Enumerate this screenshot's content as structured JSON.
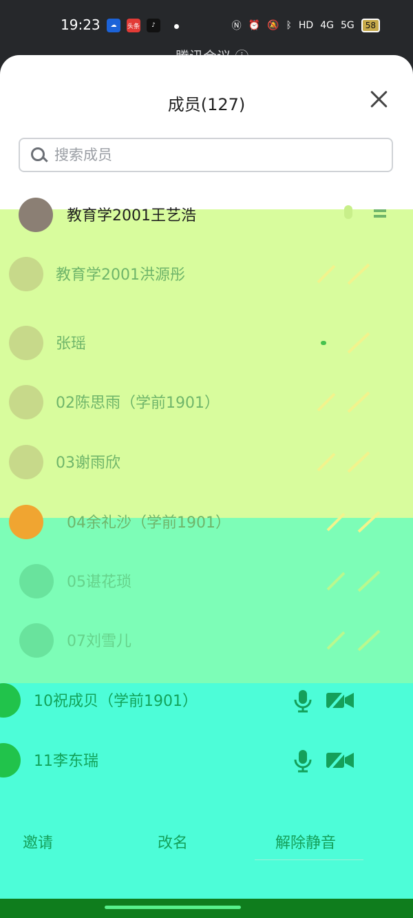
{
  "status_bar": {
    "time": "19:23",
    "apps": [
      "头条",
      "♪"
    ],
    "network_labels": [
      "4G",
      "5G"
    ],
    "battery": "58"
  },
  "behind_title": "腾讯会议 ⓘ",
  "header": {
    "title": "成员(127)"
  },
  "search": {
    "placeholder": "搜索成员",
    "value": ""
  },
  "members": [
    {
      "name": "教育学2001王艺浩",
      "mic": true,
      "cam": true,
      "hand": true
    },
    {
      "name": "教育学2001洪源彤",
      "mic": true,
      "cam": true
    },
    {
      "name": "张瑶",
      "mic": true,
      "cam": true
    },
    {
      "name": "02陈思雨（学前1901）",
      "mic": true,
      "cam": true
    },
    {
      "name": "03谢雨欣",
      "mic": true,
      "cam": true
    },
    {
      "name": "04余礼沙（学前1901）",
      "mic": true,
      "cam": true
    },
    {
      "name": "05谌花琐",
      "mic": true,
      "cam": true
    },
    {
      "name": "07刘雪儿",
      "mic": true,
      "cam": true
    },
    {
      "name": "10祝成贝（学前1901）",
      "mic": true,
      "cam": true
    },
    {
      "name": "11李东瑞",
      "mic": true,
      "cam": true
    }
  ],
  "footer": {
    "invite": "邀请",
    "rename": "改名",
    "unmute": "解除静音"
  },
  "colors": {
    "band_yellow": "#d8fc9d",
    "band_green": "#7dfdb7",
    "band_cyan": "#4dfdd8",
    "accent_green": "#14a05a"
  }
}
